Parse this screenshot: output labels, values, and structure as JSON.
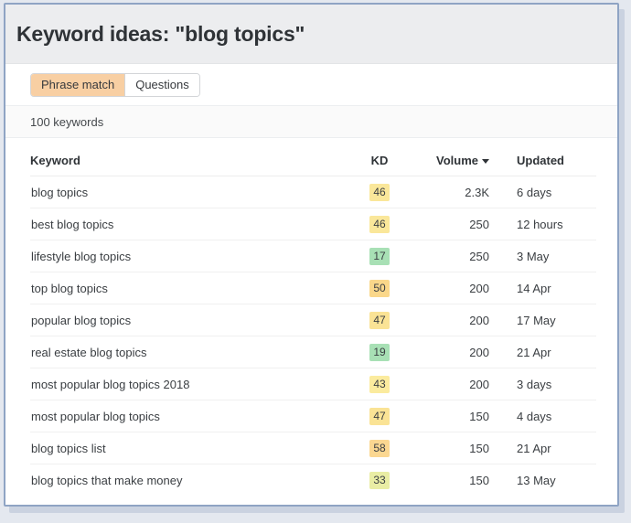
{
  "page": {
    "title": "Keyword ideas: \"blog topics\"",
    "background_color": "#e4e8ef",
    "card_border_color": "#8fa4c4"
  },
  "tabs": [
    {
      "label": "Phrase match",
      "active": true
    },
    {
      "label": "Questions",
      "active": false
    }
  ],
  "summary": {
    "count_label": "100 keywords"
  },
  "table": {
    "columns": [
      {
        "key": "keyword",
        "label": "Keyword",
        "align": "left"
      },
      {
        "key": "kd",
        "label": "KD",
        "align": "center"
      },
      {
        "key": "volume",
        "label": "Volume",
        "align": "right",
        "sort": "desc",
        "sort_icon": "caret-down-icon"
      },
      {
        "key": "updated",
        "label": "Updated",
        "align": "left"
      }
    ],
    "rows": [
      {
        "keyword": "blog topics",
        "kd": "46",
        "kd_color": "#fae79a",
        "volume": "2.3K",
        "updated": "6 days"
      },
      {
        "keyword": "best blog topics",
        "kd": "46",
        "kd_color": "#fae79a",
        "volume": "250",
        "updated": "12 hours"
      },
      {
        "keyword": "lifestyle blog topics",
        "kd": "17",
        "kd_color": "#a8e0b5",
        "volume": "250",
        "updated": "3 May"
      },
      {
        "keyword": "top blog topics",
        "kd": "50",
        "kd_color": "#fad78a",
        "volume": "200",
        "updated": "14 Apr"
      },
      {
        "keyword": "popular blog topics",
        "kd": "47",
        "kd_color": "#fae395",
        "volume": "200",
        "updated": "17 May"
      },
      {
        "keyword": "real estate blog topics",
        "kd": "19",
        "kd_color": "#a8e0b5",
        "volume": "200",
        "updated": "21 Apr"
      },
      {
        "keyword": "most popular blog topics 2018",
        "kd": "43",
        "kd_color": "#fbeb9e",
        "volume": "200",
        "updated": "3 days"
      },
      {
        "keyword": "most popular blog topics",
        "kd": "47",
        "kd_color": "#fae395",
        "volume": "150",
        "updated": "4 days"
      },
      {
        "keyword": "blog topics list",
        "kd": "58",
        "kd_color": "#fbd791",
        "volume": "150",
        "updated": "21 Apr"
      },
      {
        "keyword": "blog topics that make money",
        "kd": "33",
        "kd_color": "#e9eda4",
        "volume": "150",
        "updated": "13 May"
      }
    ]
  }
}
